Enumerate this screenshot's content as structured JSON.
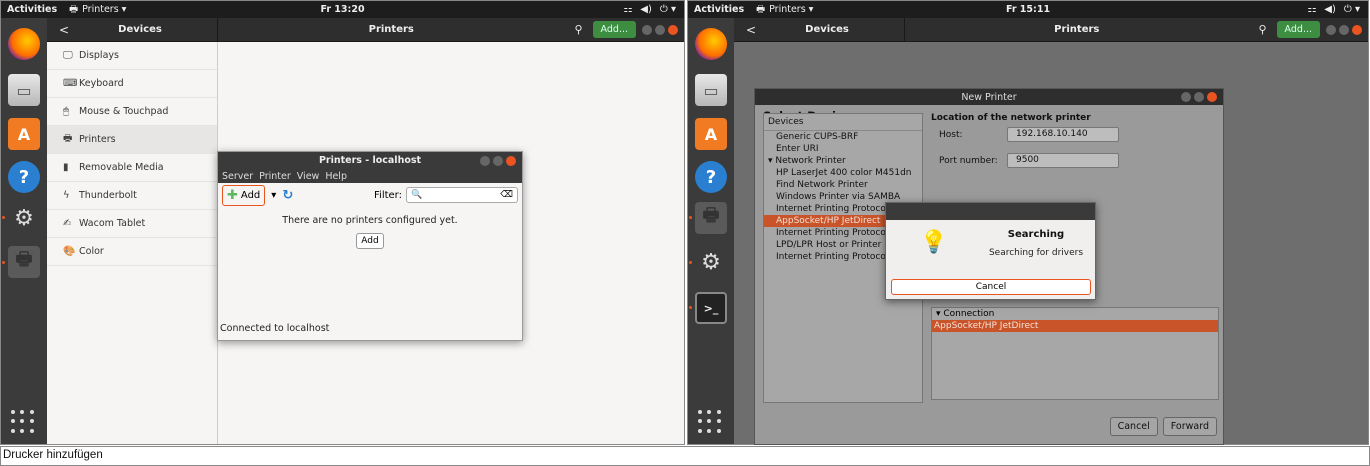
{
  "left": {
    "topbar": {
      "activities": "Activities",
      "app": "Printers ▾",
      "clock": "Fr 13:20",
      "tray": [
        "⚏",
        "◀)",
        "⏻ ▾"
      ]
    },
    "header": {
      "back": "<",
      "panel_title": "Devices",
      "title": "Printers",
      "search": "⚲",
      "add": "Add..."
    },
    "sidebar": [
      {
        "icon": "🖵",
        "label": "Displays"
      },
      {
        "icon": "⌨",
        "label": "Keyboard"
      },
      {
        "icon": "🖱",
        "label": "Mouse & Touchpad"
      },
      {
        "icon": "🖶",
        "label": "Printers",
        "selected": true
      },
      {
        "icon": "▮",
        "label": "Removable Media"
      },
      {
        "icon": "ϟ",
        "label": "Thunderbolt"
      },
      {
        "icon": "✍",
        "label": "Wacom Tablet"
      },
      {
        "icon": "🎨",
        "label": "Color"
      }
    ],
    "printers_window": {
      "title": "Printers - localhost",
      "menu": [
        "Server",
        "Printer",
        "View",
        "Help"
      ],
      "add_label": "Add",
      "filter_label": "Filter:",
      "empty_text": "There are no printers configured yet.",
      "add_center": "Add",
      "status": "Connected to localhost"
    }
  },
  "right": {
    "topbar": {
      "activities": "Activities",
      "app": "Printers ▾",
      "clock": "Fr 15:11",
      "tray": [
        "⚏",
        "◀)",
        "⏻ ▾"
      ]
    },
    "header": {
      "back": "<",
      "panel_title": "Devices",
      "title": "Printers",
      "search": "⚲",
      "add": "Add..."
    },
    "new_printer": {
      "title": "New Printer",
      "heading": "Select Device",
      "devices_header": "Devices",
      "devices": [
        {
          "label": "Generic CUPS-BRF"
        },
        {
          "label": "Enter URI"
        },
        {
          "label": "▾ Network Printer",
          "group": true
        },
        {
          "label": "HP LaserJet 400 color M451dn"
        },
        {
          "label": "Find Network Printer"
        },
        {
          "label": "Windows Printer via SAMBA"
        },
        {
          "label": "Internet Printing Protocol (https)"
        },
        {
          "label": "AppSocket/HP JetDirect",
          "selected": true
        },
        {
          "label": "Internet Printing Protocol (ipp)"
        },
        {
          "label": "LPD/LPR Host or Printer"
        },
        {
          "label": "Internet Printing Protocol (http)"
        }
      ],
      "location_title": "Location of the network printer",
      "host_label": "Host:",
      "host_value": "192.168.10.140",
      "port_label": "Port number:",
      "port_value": "9500",
      "connection_header": "▾ Connection",
      "connection_value": "AppSocket/HP JetDirect",
      "cancel": "Cancel",
      "forward": "Forward"
    },
    "searching": {
      "title": "Searching",
      "desc": "Searching for drivers",
      "cancel": "Cancel"
    }
  },
  "caption": "Drucker hinzufügen"
}
